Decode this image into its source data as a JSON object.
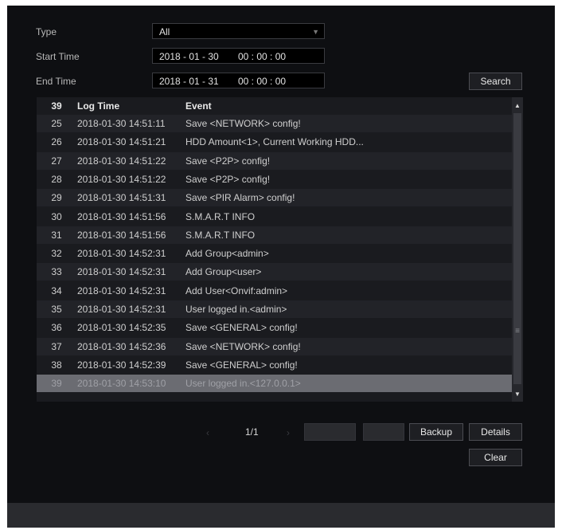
{
  "filters": {
    "type_label": "Type",
    "type_value": "All",
    "start_label": "Start Time",
    "start_date": "2018 - 01 - 30",
    "start_time": "00 : 00 : 00",
    "end_label": "End Time",
    "end_date": "2018 - 01 - 31",
    "end_time": "00 : 00 : 00",
    "search_label": "Search"
  },
  "table": {
    "header": {
      "count": "39",
      "log_time": "Log Time",
      "event": "Event"
    },
    "rows": [
      {
        "no": "25",
        "time": "2018-01-30 14:51:11",
        "event": "Save <NETWORK> config!"
      },
      {
        "no": "26",
        "time": "2018-01-30 14:51:21",
        "event": "HDD Amount<1>, Current Working HDD..."
      },
      {
        "no": "27",
        "time": "2018-01-30 14:51:22",
        "event": "Save <P2P> config!"
      },
      {
        "no": "28",
        "time": "2018-01-30 14:51:22",
        "event": "Save <P2P> config!"
      },
      {
        "no": "29",
        "time": "2018-01-30 14:51:31",
        "event": "Save <PIR Alarm> config!"
      },
      {
        "no": "30",
        "time": "2018-01-30 14:51:56",
        "event": "S.M.A.R.T INFO"
      },
      {
        "no": "31",
        "time": "2018-01-30 14:51:56",
        "event": "S.M.A.R.T INFO"
      },
      {
        "no": "32",
        "time": "2018-01-30 14:52:31",
        "event": "Add Group<admin>"
      },
      {
        "no": "33",
        "time": "2018-01-30 14:52:31",
        "event": "Add Group<user>"
      },
      {
        "no": "34",
        "time": "2018-01-30 14:52:31",
        "event": "Add User<Onvif:admin>"
      },
      {
        "no": "35",
        "time": "2018-01-30 14:52:31",
        "event": "User logged in.<admin>"
      },
      {
        "no": "36",
        "time": "2018-01-30 14:52:35",
        "event": "Save <GENERAL> config!"
      },
      {
        "no": "37",
        "time": "2018-01-30 14:52:36",
        "event": "Save <NETWORK> config!"
      },
      {
        "no": "38",
        "time": "2018-01-30 14:52:39",
        "event": "Save <GENERAL> config!"
      },
      {
        "no": "39",
        "time": "2018-01-30 14:53:10",
        "event": "User logged in.<127.0.0.1>"
      }
    ]
  },
  "pager": {
    "page": "1/1"
  },
  "actions": {
    "backup_label": "Backup",
    "details_label": "Details",
    "clear_label": "Clear"
  }
}
